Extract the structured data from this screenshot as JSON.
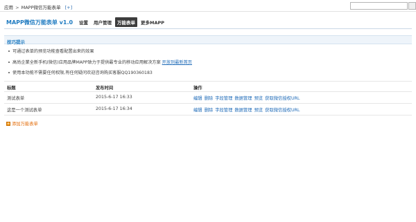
{
  "breadcrumb": {
    "root": "应用",
    "separator": ">",
    "current": "MAPP微信万能表单",
    "add": "[+]"
  },
  "app_title": "MAPP微信万能表单 v1.0",
  "nav": [
    {
      "label": "设置",
      "active": false
    },
    {
      "label": "用户管理",
      "active": false
    },
    {
      "label": "万能表单",
      "active": true
    },
    {
      "label": "更多MAPP",
      "active": false
    }
  ],
  "tips": {
    "title": "技巧提示",
    "items": [
      {
        "text": "可通过表单的预览功能查看配置出来的效果",
        "link": ""
      },
      {
        "text": "高尚企業全新手机(微信)应用品牌MAPP致力于提供最专业的移动应用解决方案 ",
        "link": "开放到最新首页"
      },
      {
        "text": "使用本功能不需要任何权限,有任何疑问欢迎咨询购买客服QQ190360183",
        "link": ""
      }
    ]
  },
  "table": {
    "headers": [
      "标题",
      "发布时间",
      "操作"
    ],
    "rows": [
      {
        "title": "测试表单",
        "time": "2015-6-17 16:33"
      },
      {
        "title": "这是一个测试表单",
        "time": "2015-6-17 16:34"
      }
    ],
    "actions": [
      "编辑",
      "删除",
      "字段管理",
      "数据管理",
      "预览",
      "获取微信授权URL"
    ]
  },
  "add_form_label": "添加万能表单",
  "colors": {
    "accent": "#1f7bc1",
    "link": "#1f6bb8",
    "add_link": "#e36c09",
    "active_tab_bg": "#3c3c3c"
  }
}
